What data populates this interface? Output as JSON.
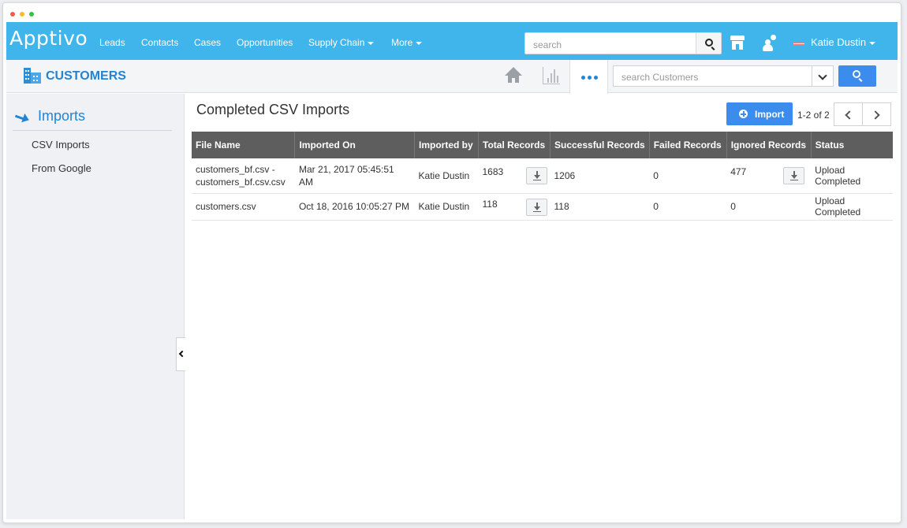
{
  "app": {
    "logo": "Apptivo",
    "nav": [
      {
        "label": "Leads",
        "has_caret": false
      },
      {
        "label": "Contacts",
        "has_caret": false
      },
      {
        "label": "Cases",
        "has_caret": false
      },
      {
        "label": "Opportunities",
        "has_caret": false
      },
      {
        "label": "Supply Chain",
        "has_caret": true
      },
      {
        "label": "More",
        "has_caret": true
      }
    ],
    "search_placeholder": "search",
    "user_name": "Katie Dustin",
    "accent_color": "#3fb5ec"
  },
  "subheader": {
    "module_title": "CUSTOMERS",
    "search_placeholder": "search Customers",
    "icons": [
      "home-icon",
      "bar-chart-icon",
      "more-dots-icon",
      "chevron-down-icon",
      "search-icon"
    ]
  },
  "sidebar": {
    "title": "Imports",
    "items": [
      {
        "label": "CSV Imports"
      },
      {
        "label": "From Google"
      }
    ]
  },
  "main": {
    "title": "Completed CSV Imports",
    "import_label": "Import",
    "pager_text": "1-2 of 2",
    "columns": [
      "File Name",
      "Imported On",
      "Imported by",
      "Total Records",
      "Successful Records",
      "Failed Records",
      "Ignored Records",
      "Status"
    ],
    "rows": [
      {
        "file_line1": "customers_bf.csv -",
        "file_line2": "customers_bf.csv.csv",
        "imported_on_line1": "Mar 21, 2017 05:45:51",
        "imported_on_line2": "AM",
        "imported_by": "Katie Dustin",
        "total": "1683",
        "successful": "1206",
        "failed": "0",
        "ignored": "477",
        "status": "Upload Completed"
      },
      {
        "file_line1": "customers.csv",
        "file_line2": "",
        "imported_on_line1": "Oct 18, 2016 10:05:27 PM",
        "imported_on_line2": "",
        "imported_by": "Katie Dustin",
        "total": "118",
        "successful": "118",
        "failed": "0",
        "ignored": "0",
        "status": "Upload Completed"
      }
    ]
  }
}
